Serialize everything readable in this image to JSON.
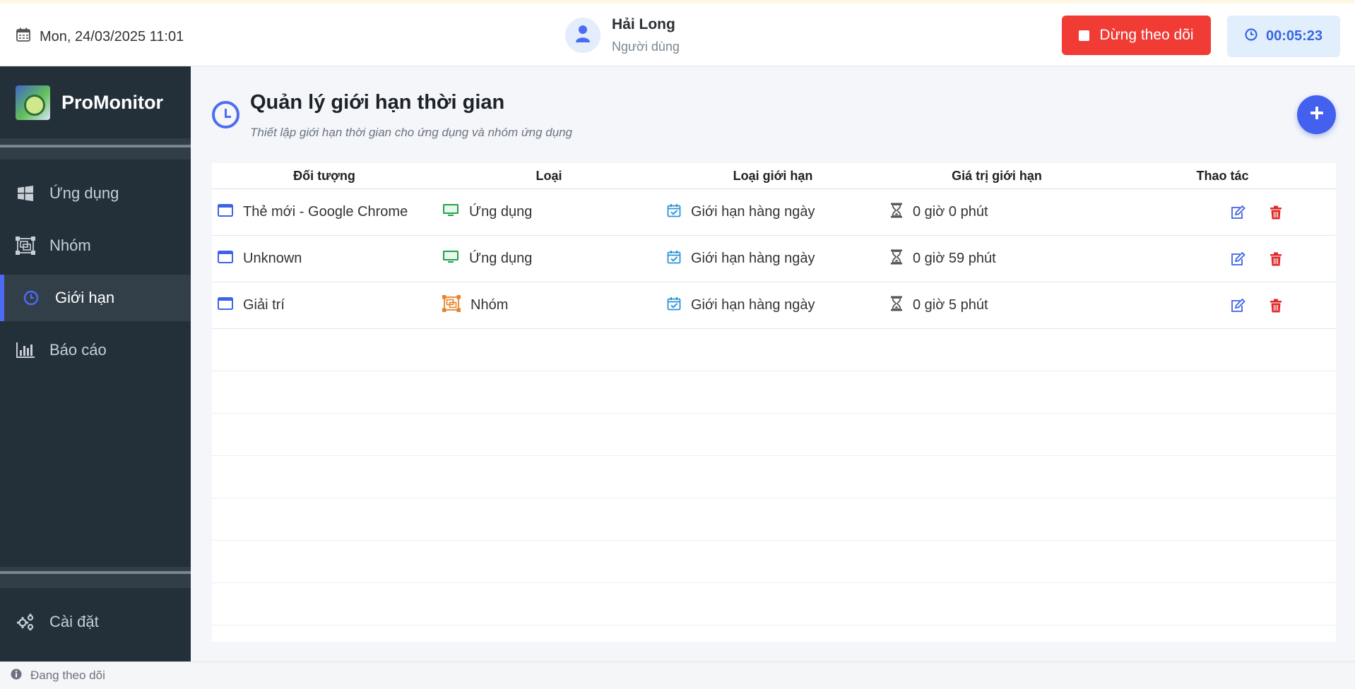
{
  "header": {
    "datetime": "Mon, 24/03/2025 11:01",
    "user_name": "Hải Long",
    "user_role": "Người dùng",
    "stop_label": "Dừng theo dõi",
    "timer": "00:05:23"
  },
  "sidebar": {
    "brand": "ProMonitor",
    "items": [
      {
        "label": "Ứng dụng",
        "icon": "windows-icon"
      },
      {
        "label": "Nhóm",
        "icon": "group-icon"
      },
      {
        "label": "Giới hạn",
        "icon": "clock-icon",
        "active": true
      },
      {
        "label": "Báo cáo",
        "icon": "bar-chart-icon"
      }
    ],
    "settings": {
      "label": "Cài đặt",
      "icon": "gears-icon"
    }
  },
  "page": {
    "title": "Quản lý giới hạn thời gian",
    "subtitle": "Thiết lập giới hạn thời gian cho ứng dụng và nhóm ứng dụng"
  },
  "table": {
    "columns": [
      "Đối tượng",
      "Loại",
      "Loại giới hạn",
      "Giá trị giới hạn",
      "Thao tác"
    ],
    "rows": [
      {
        "target": "Thẻ mới - Google Chrome",
        "type": "Ứng dụng",
        "limit_type": "Giới hạn hàng ngày",
        "limit_value": "0 giờ 0 phút"
      },
      {
        "target": "Unknown",
        "type": "Ứng dụng",
        "limit_type": "Giới hạn hàng ngày",
        "limit_value": "0 giờ 59 phút"
      },
      {
        "target": "Giải trí",
        "type": "Nhóm",
        "limit_type": "Giới hạn hàng ngày",
        "limit_value": "0 giờ 5 phút"
      }
    ]
  },
  "footer": {
    "status": "Đang theo dõi"
  },
  "colors": {
    "accent": "#4360ee",
    "danger": "#f13b35",
    "sidebar_bg": "#243039",
    "app_type_green": "#22a04b",
    "group_type_orange": "#e8822a"
  }
}
